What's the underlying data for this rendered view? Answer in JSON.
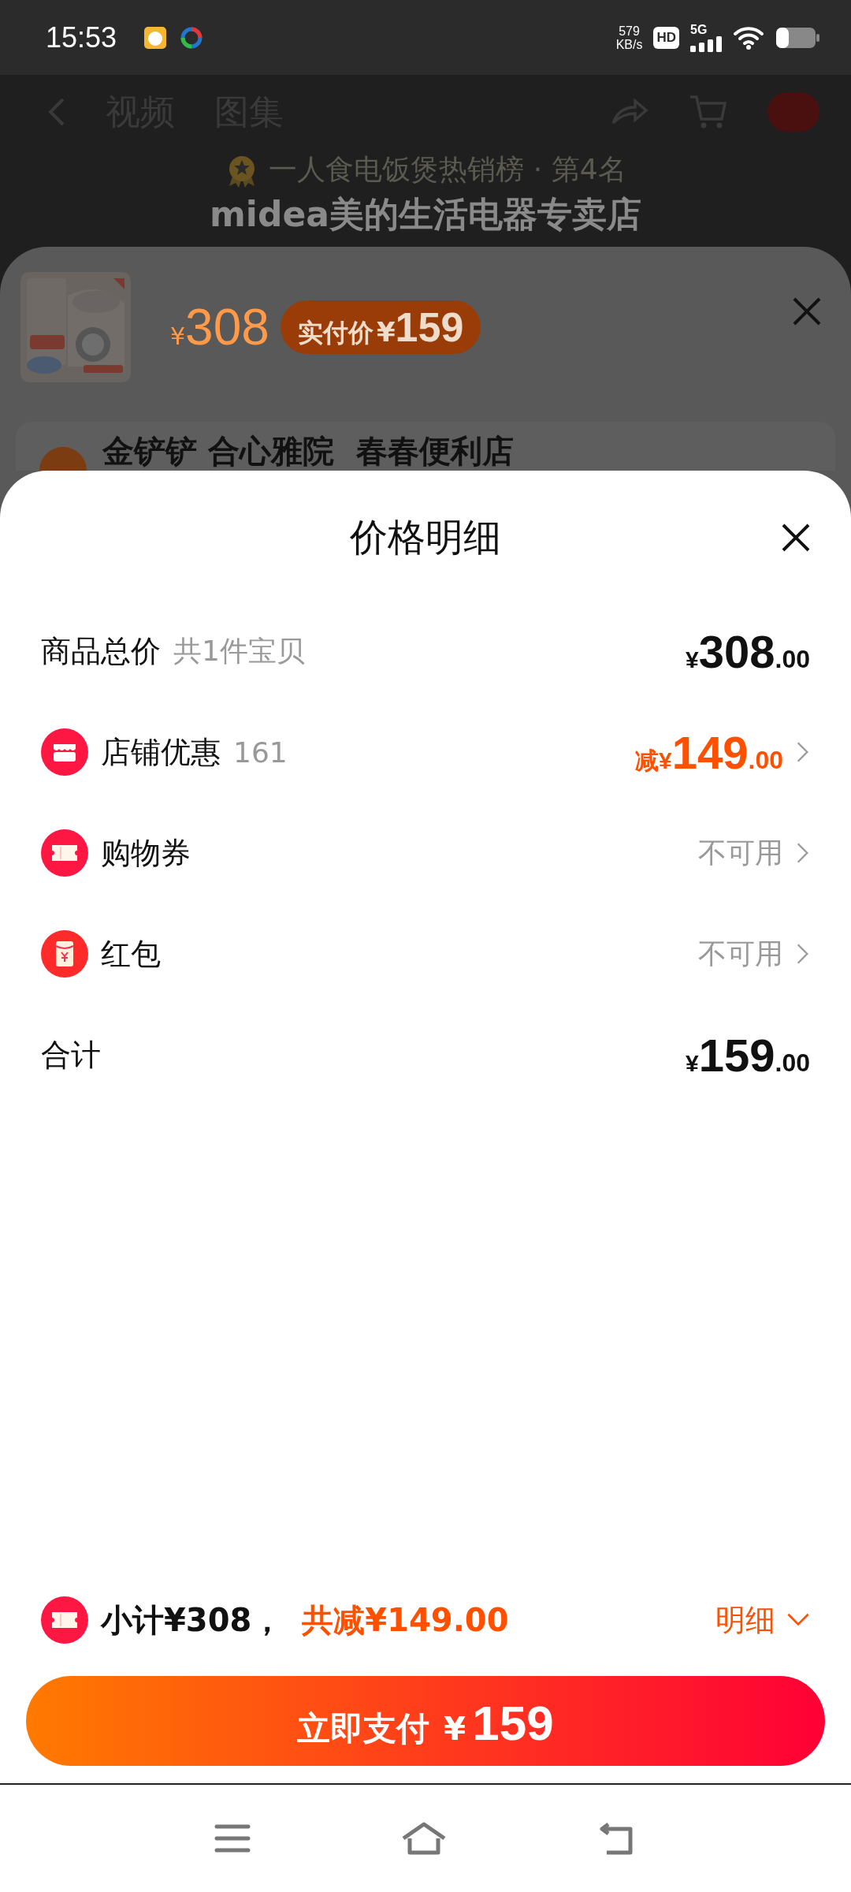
{
  "status_bar": {
    "time": "15:53",
    "net_speed": "579",
    "net_unit": "KB/s",
    "hd_badge": "HD",
    "network": "5G"
  },
  "background_page": {
    "tabs": [
      "视频",
      "图集"
    ],
    "rank": "一人食电饭煲热销榜 · 第4名",
    "shop_name": "midea美的生活电器专卖店"
  },
  "product_sheet": {
    "price_symbol": "¥",
    "price": "308",
    "paid_label": "实付价",
    "paid_symbol": "¥",
    "paid_amount": "159",
    "stores": "金铲铲 合心雅院  春春便利店"
  },
  "detail_sheet": {
    "title": "价格明细",
    "rows": [
      {
        "kind": "total",
        "label": "商品总价",
        "note": "共1件宝贝",
        "prefix": "¥",
        "integer": "308",
        "decimal": ".00"
      },
      {
        "kind": "discount",
        "label": "店铺优惠",
        "note": "161",
        "prefix": "减¥",
        "integer": "149",
        "decimal": ".00"
      },
      {
        "kind": "coupon",
        "label": "购物券",
        "status": "不可用"
      },
      {
        "kind": "red_packet",
        "label": "红包",
        "status": "不可用"
      },
      {
        "kind": "total",
        "label": "合计",
        "prefix": "¥",
        "integer": "159",
        "decimal": ".00"
      }
    ]
  },
  "footer": {
    "subtotal": "小计¥308，",
    "reduction": "共减¥149.00",
    "detail_toggle": "明细",
    "pay_label": "立即支付",
    "pay_symbol": "¥",
    "pay_amount": "159"
  }
}
